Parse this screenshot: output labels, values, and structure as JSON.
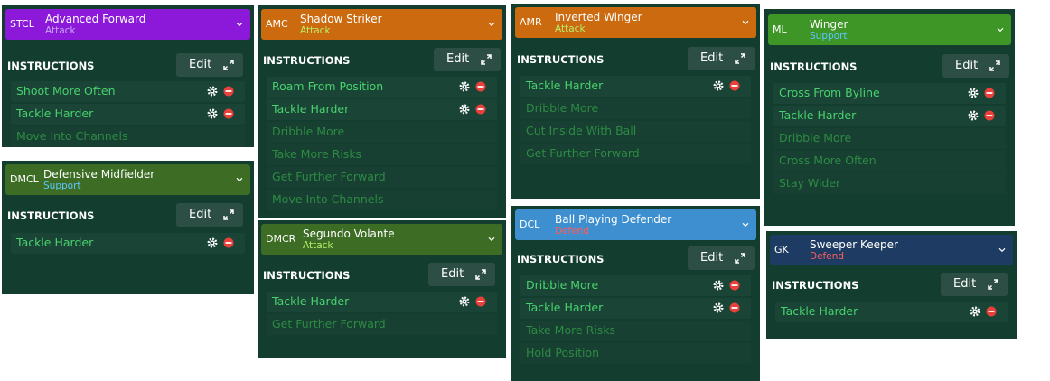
{
  "panels": [
    {
      "pos": "STCL",
      "name": "Advanced Forward",
      "duty": "Attack",
      "header_color": "#8c19d9",
      "duty_color": "#c4a6f0",
      "instructions_label": "INSTRUCTIONS",
      "edit_label": "Edit",
      "items": [
        {
          "label": "Shoot More Often",
          "active": true
        },
        {
          "label": "Tackle Harder",
          "active": true
        },
        {
          "label": "Move Into Channels",
          "active": false
        }
      ]
    },
    {
      "pos": "DMCL",
      "name": "Defensive Midfielder",
      "duty": "Support",
      "header_color": "#3d6d25",
      "duty_color": "#5cc6ff",
      "instructions_label": "INSTRUCTIONS",
      "edit_label": "Edit",
      "items": [
        {
          "label": "Tackle Harder",
          "active": true
        }
      ]
    },
    {
      "pos": "AMC",
      "name": "Shadow Striker",
      "duty": "Attack",
      "header_color": "#cc6a10",
      "duty_color": "#b6ee6a",
      "instructions_label": "INSTRUCTIONS",
      "edit_label": "Edit",
      "items": [
        {
          "label": "Roam From Position",
          "active": true
        },
        {
          "label": "Tackle Harder",
          "active": true
        },
        {
          "label": "Dribble More",
          "active": false
        },
        {
          "label": "Take More Risks",
          "active": false
        },
        {
          "label": "Get Further Forward",
          "active": false
        },
        {
          "label": "Move Into Channels",
          "active": false
        }
      ]
    },
    {
      "pos": "DMCR",
      "name": "Segundo Volante",
      "duty": "Attack",
      "header_color": "#3d6d25",
      "duty_color": "#b6ee6a",
      "instructions_label": "INSTRUCTIONS",
      "edit_label": "Edit",
      "items": [
        {
          "label": "Tackle Harder",
          "active": true
        },
        {
          "label": "Get Further Forward",
          "active": false
        }
      ]
    },
    {
      "pos": "AMR",
      "name": "Inverted Winger",
      "duty": "Attack",
      "header_color": "#cc6a10",
      "duty_color": "#b6ee6a",
      "instructions_label": "INSTRUCTIONS",
      "edit_label": "Edit",
      "items": [
        {
          "label": "Tackle Harder",
          "active": true
        },
        {
          "label": "Dribble More",
          "active": false
        },
        {
          "label": "Cut Inside With Ball",
          "active": false
        },
        {
          "label": "Get Further Forward",
          "active": false
        }
      ]
    },
    {
      "pos": "DCL",
      "name": "Ball Playing Defender",
      "duty": "Defend",
      "header_color": "#3e8fcf",
      "duty_color": "#ff5c5c",
      "instructions_label": "INSTRUCTIONS",
      "edit_label": "Edit",
      "items": [
        {
          "label": "Dribble More",
          "active": true
        },
        {
          "label": "Tackle Harder",
          "active": true
        },
        {
          "label": "Take More Risks",
          "active": false
        },
        {
          "label": "Hold Position",
          "active": false
        }
      ]
    },
    {
      "pos": "ML",
      "name": "Winger",
      "duty": "Support",
      "header_color": "#3d9626",
      "duty_color": "#5cc6ff",
      "instructions_label": "INSTRUCTIONS",
      "edit_label": "Edit",
      "items": [
        {
          "label": "Cross From Byline",
          "active": true
        },
        {
          "label": "Tackle Harder",
          "active": true
        },
        {
          "label": "Dribble More",
          "active": false
        },
        {
          "label": "Cross More Often",
          "active": false
        },
        {
          "label": "Stay Wider",
          "active": false
        }
      ]
    },
    {
      "pos": "GK",
      "name": "Sweeper Keeper",
      "duty": "Defend",
      "header_color": "#1e3c63",
      "duty_color": "#ff5c5c",
      "instructions_label": "INSTRUCTIONS",
      "edit_label": "Edit",
      "items": [
        {
          "label": "Tackle Harder",
          "active": true
        }
      ]
    }
  ],
  "icons": {
    "chevron": "chevron-down-icon",
    "expand": "expand-icon",
    "gear": "gear-icon",
    "remove": "remove-icon"
  },
  "colors": {
    "panel_bg": "#133e2f",
    "active_text": "#49d26d",
    "inactive_text": "#2d8a43",
    "remove_red": "#e8403a"
  }
}
